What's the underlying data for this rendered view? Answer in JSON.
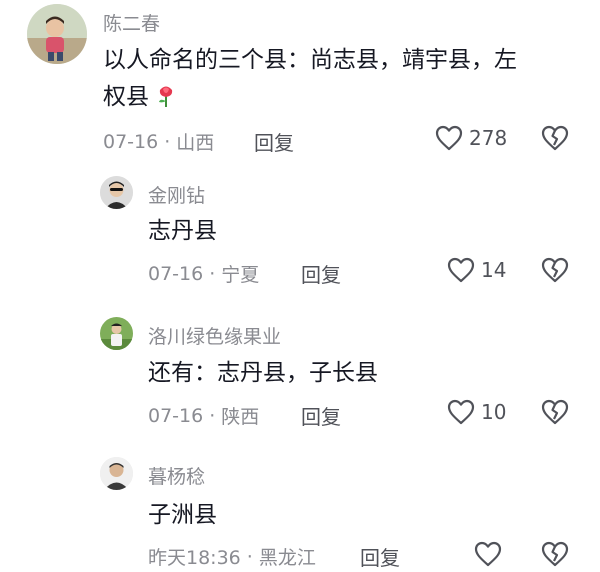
{
  "comments": [
    {
      "username": "陈二春",
      "text_line1": "以人命名的三个县：尚志县，靖宇县，左",
      "text_line2": "权县",
      "emoji": "rose-emoji",
      "date": "07-16",
      "location": "山西",
      "reply_label": "回复",
      "likes": "278"
    },
    {
      "username": "金刚钻",
      "text": "志丹县",
      "date": "07-16",
      "location": "宁夏",
      "reply_label": "回复",
      "likes": "14"
    },
    {
      "username": "洛川绿色缘果业",
      "text": "还有：志丹县，子长县",
      "date": "07-16",
      "location": "陕西",
      "reply_label": "回复",
      "likes": "10"
    },
    {
      "username": "暮杨稔",
      "text": "子洲县",
      "date": "昨天18:36",
      "location": "黑龙江",
      "reply_label": "回复",
      "likes": ""
    }
  ],
  "separator": "·",
  "icons": {
    "like": "heart-outline-icon",
    "dislike": "broken-heart-icon"
  },
  "colors": {
    "text": "#161823",
    "meta": "#8a8b91",
    "action": "#505259"
  }
}
